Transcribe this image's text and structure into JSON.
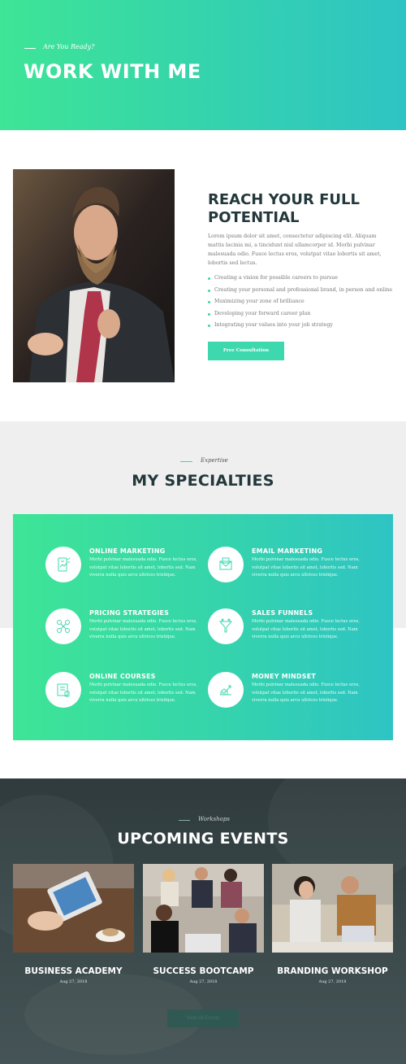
{
  "hero": {
    "eyebrow": "Are You Ready?",
    "title": "WORK WITH ME"
  },
  "about": {
    "title_line1": "REACH YOUR FULL",
    "title_line2": "POTENTIAL",
    "paragraph": "Lorem ipsum dolor sit amet, consectetur adipiscing elit. Aliquam mattis lacinia mi, a tincidunt nisl ullamcorper id. Morbi pulvinar malesuada odio. Fusce lectus eros, volutpat vitae lobortis sit amet, lobortis sed lectus.",
    "bullets": [
      "Creating a vision for possible careers to pursue",
      "Creating your personal and professional brand, in person and online",
      "Maximizing your zone of brilliance",
      "Developing your forward career plan",
      "Integrating your values into your job strategy"
    ],
    "button": "Free Consultation"
  },
  "specialties": {
    "eyebrow": "Expertise",
    "title": "MY SPECIALTIES",
    "items": [
      {
        "title": "ONLINE MARKETING",
        "desc": "Morbi pulvinar malesuada odio. Fusce lectus eros, volutpat vitae lobortis sit amet, lobortis sed. Nam viverra nulla quis arcu ultrices tristique.",
        "icon": "marketing-icon"
      },
      {
        "title": "EMAIL MARKETING",
        "desc": "Morbi pulvinar malesuada odio. Fusce lectus eros, volutpat vitae lobortis sit amet, lobortis sed. Nam viverra nulla quis arcu ultrices tristique.",
        "icon": "email-icon"
      },
      {
        "title": "PRICING STRATEGIES",
        "desc": "Morbi pulvinar malesuada odio. Fusce lectus eros, volutpat vitae lobortis sit amet, lobortis sed. Nam viverra nulla quis arcu ultrices tristique.",
        "icon": "strategy-icon"
      },
      {
        "title": "SALES FUNNELS",
        "desc": "Morbi pulvinar malesuada odio. Fusce lectus eros, volutpat vitae lobortis sit amet, lobortis sed. Nam viverra nulla quis arcu ultrices tristique.",
        "icon": "funnel-icon"
      },
      {
        "title": "ONLINE COURSES",
        "desc": "Morbi pulvinar malesuada odio. Fusce lectus eros, volutpat vitae lobortis sit amet, lobortis sed. Nam viverra nulla quis arcu ultrices tristique.",
        "icon": "courses-icon"
      },
      {
        "title": "MONEY MINDSET",
        "desc": "Morbi pulvinar malesuada odio. Fusce lectus eros, volutpat vitae lobortis sit amet, lobortis sed. Nam viverra nulla quis arcu ultrices tristique.",
        "icon": "money-icon"
      }
    ]
  },
  "events": {
    "eyebrow": "Workshops",
    "title": "UPCOMING EVENTS",
    "items": [
      {
        "name": "BUSINESS ACADEMY",
        "date": "Aug 27, 2018"
      },
      {
        "name": "SUCCESS BOOTCAMP",
        "date": "Aug 27, 2018"
      },
      {
        "name": "BRANDING WORKSHOP",
        "date": "Aug 27, 2018"
      }
    ],
    "button": "View All Events"
  },
  "colors": {
    "accent": "#3dd8ad",
    "gradient_start": "#3ee596",
    "gradient_end": "#2ec4c4",
    "heading": "#23383b"
  }
}
